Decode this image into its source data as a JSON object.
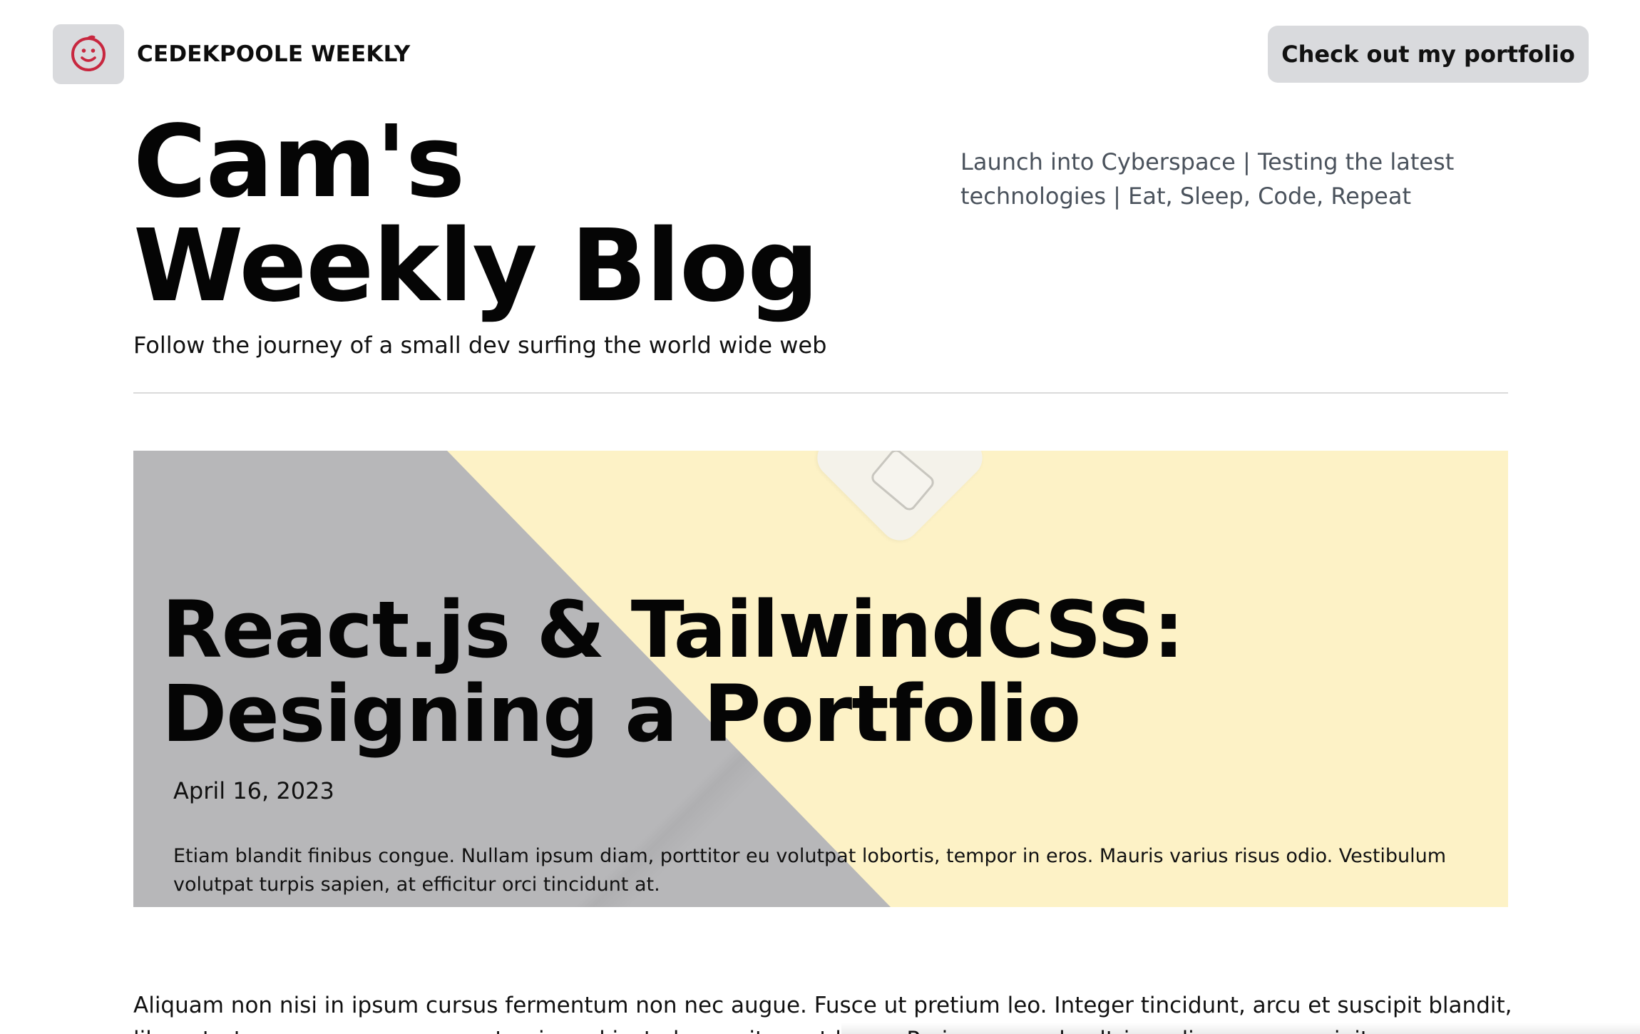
{
  "header": {
    "brand_name": "CEDEKPOOLE WEEKLY",
    "logo_icon": "smiley-face-icon",
    "portfolio_button": "Check out my portfolio"
  },
  "hero": {
    "title_line1": "Cam's",
    "title_line2": "Weekly Blog",
    "subtitle": "Follow the journey of a small dev surfing the world wide web",
    "tagline": "Launch into Cyberspace | Testing the latest technologies | Eat, Sleep, Code, Repeat"
  },
  "featured_post": {
    "title_line1": "React.js & TailwindCSS:",
    "title_line2": "Designing a Portfolio",
    "date": "April 16, 2023",
    "excerpt": "Etiam blandit finibus congue. Nullam ipsum diam, porttitor eu volutpat lobortis, tempor in eros. Mauris varius risus odio. Vestibulum volutpat turpis sapien, at efficitur orci tincidunt at."
  },
  "body": {
    "paragraph": "Aliquam non nisi in ipsum cursus fermentum non nec augue. Fusce ut pretium leo. Integer tincidunt, arcu et suscipit blandit, libero tortor accumsan arcu, eget euismod justo lacus sit amet lacus. Proin commodo ultrices diam non suscipit."
  },
  "colors": {
    "logo_tile": "#d9dadd",
    "logo_face": "#c8273f",
    "button_bg": "#d9dadd",
    "feature_yellow": "#fdf2c6",
    "feature_gray": "#b7b7b9",
    "tagline_text": "#4a525c"
  }
}
